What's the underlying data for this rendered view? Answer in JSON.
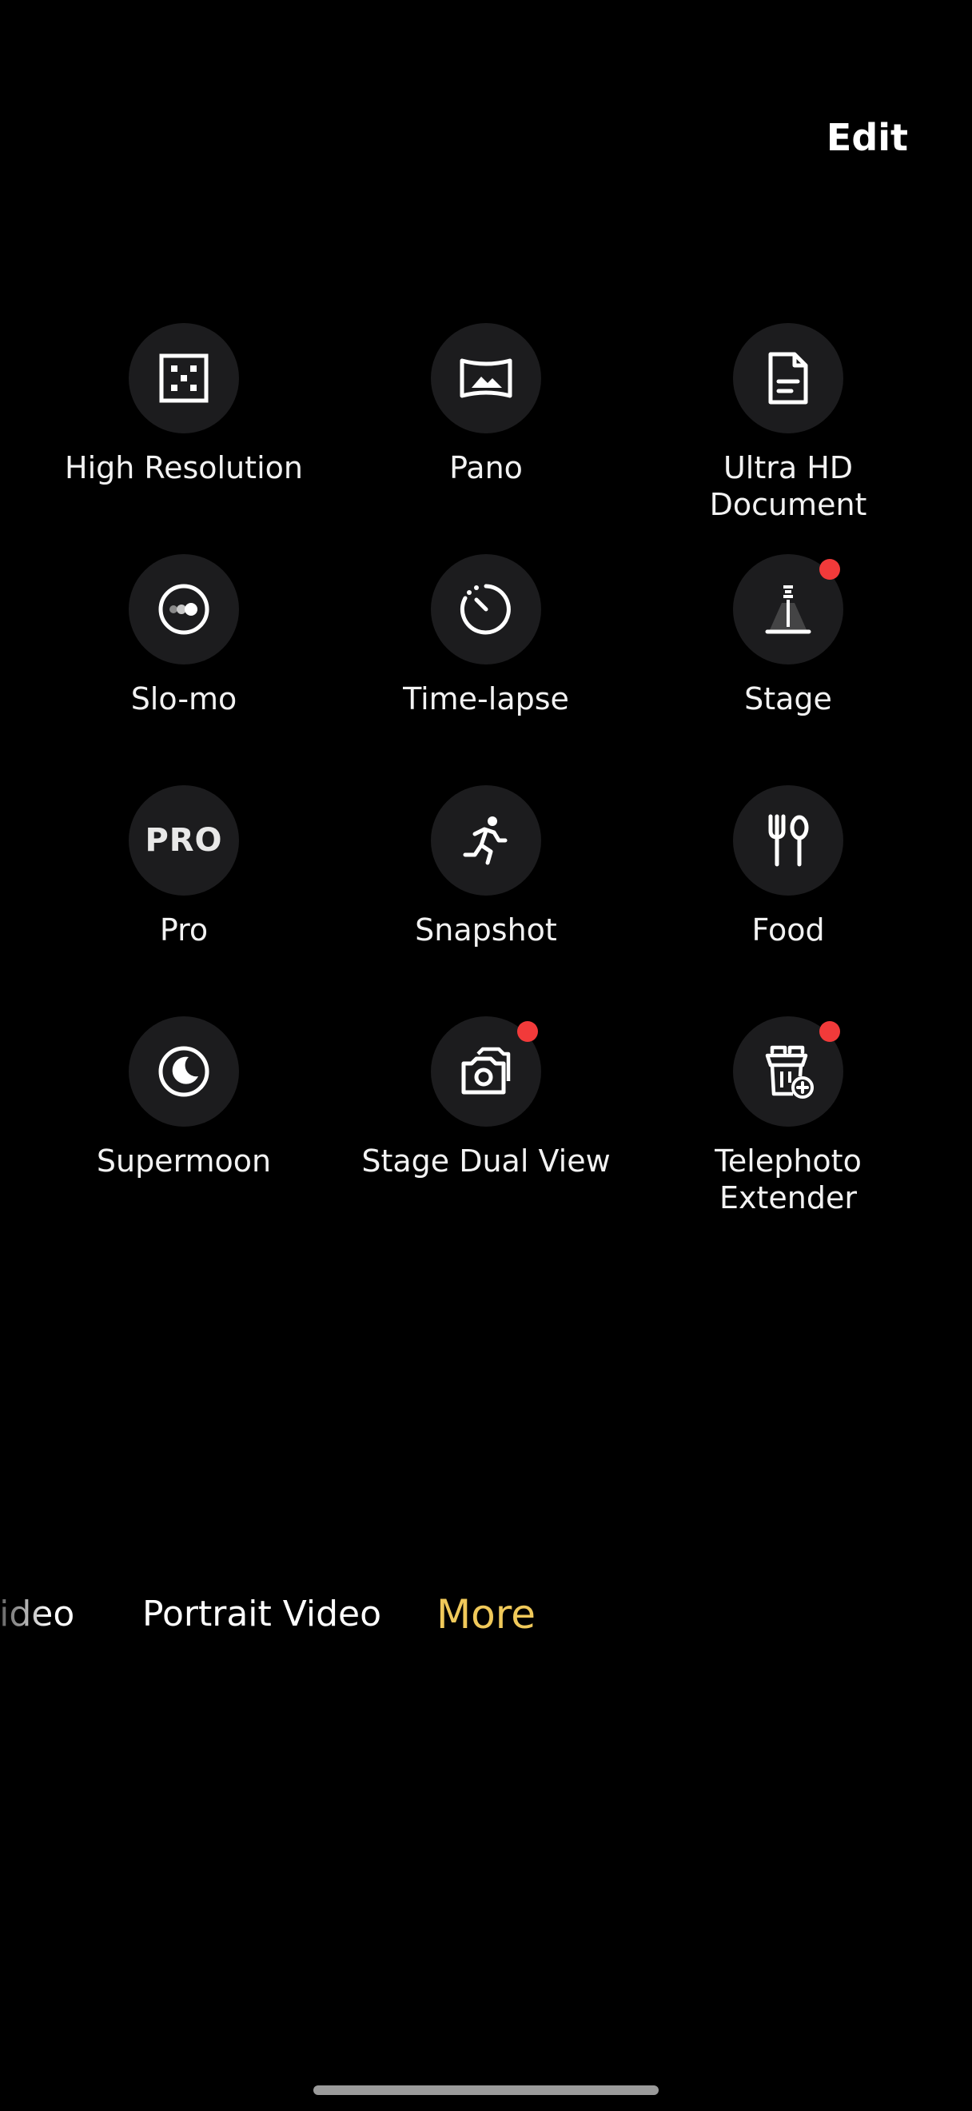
{
  "header": {
    "edit_label": "Edit"
  },
  "modes_grid": {
    "items": [
      {
        "label": "High Resolution",
        "icon": "high-resolution-icon",
        "badge": false
      },
      {
        "label": "Pano",
        "icon": "pano-icon",
        "badge": false
      },
      {
        "label": "Ultra HD Document",
        "icon": "document-icon",
        "badge": false
      },
      {
        "label": "Slo-mo",
        "icon": "slo-mo-icon",
        "badge": false
      },
      {
        "label": "Time-lapse",
        "icon": "time-lapse-icon",
        "badge": false
      },
      {
        "label": "Stage",
        "icon": "stage-icon",
        "badge": true
      },
      {
        "label": "Pro",
        "icon": "pro-icon",
        "icon_text": "PRO",
        "badge": false
      },
      {
        "label": "Snapshot",
        "icon": "running-person-icon",
        "badge": false
      },
      {
        "label": "Food",
        "icon": "fork-spoon-icon",
        "badge": false
      },
      {
        "label": "Supermoon",
        "icon": "moon-icon",
        "badge": false
      },
      {
        "label": "Stage Dual View",
        "icon": "dual-camera-icon",
        "badge": true
      },
      {
        "label": "Telephoto Extender",
        "icon": "telephoto-extender-icon",
        "badge": true
      }
    ]
  },
  "mode_bar": {
    "items": [
      "Video",
      "Portrait Video",
      "More"
    ],
    "selected": "More"
  },
  "colors": {
    "background": "#000000",
    "tile_circle": "#1c1c1e",
    "badge": "#f23a3a",
    "selected_mode": "#f0c95a"
  }
}
